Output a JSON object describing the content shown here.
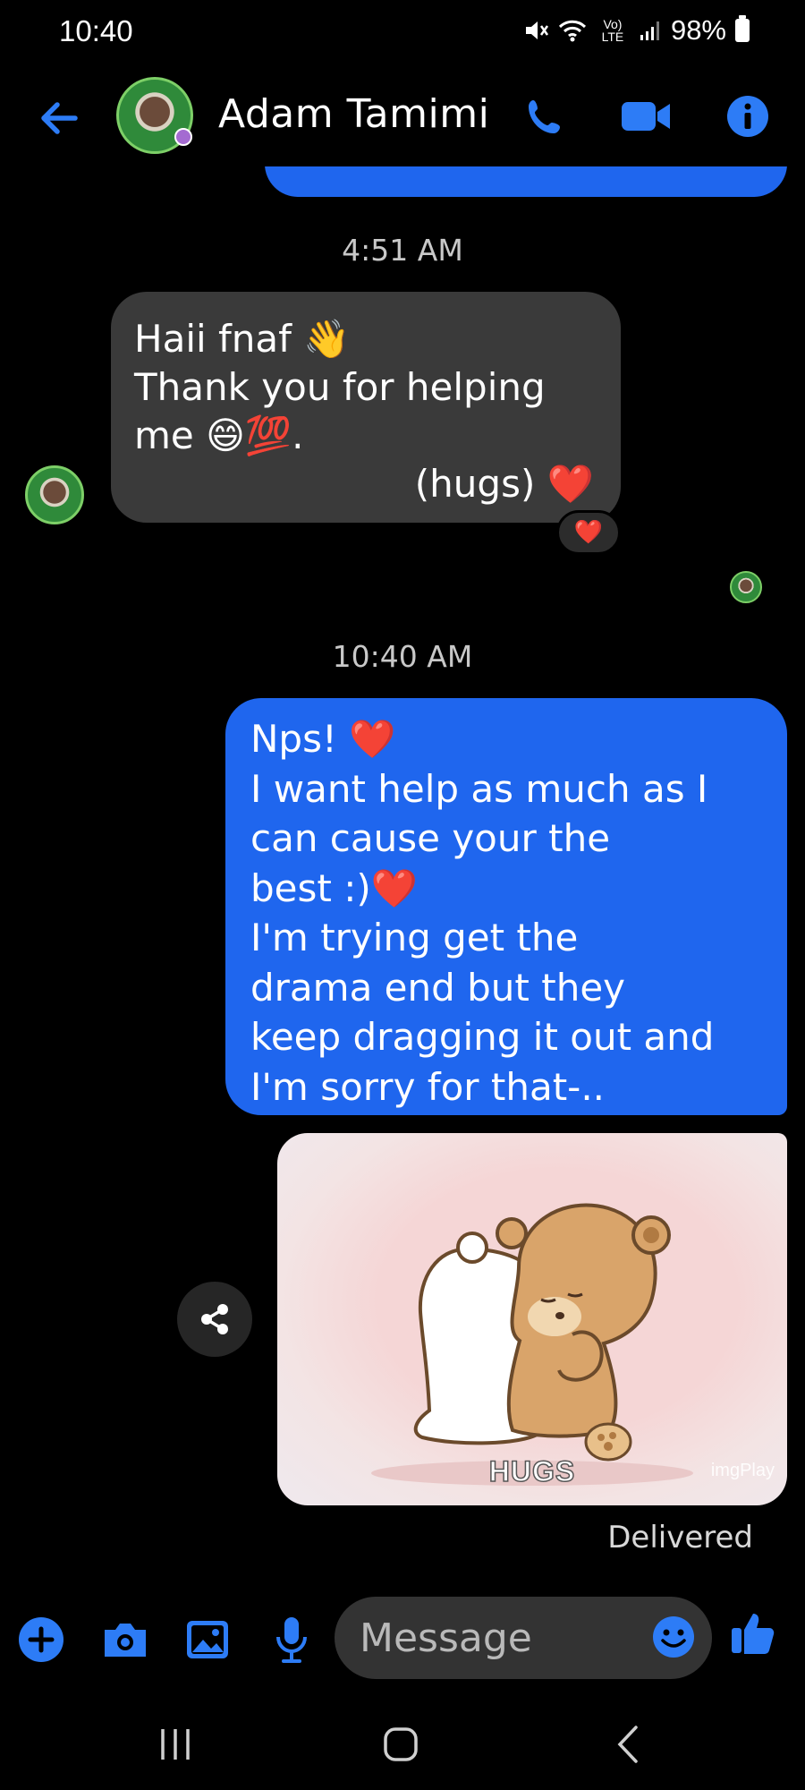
{
  "status_bar": {
    "time": "10:40",
    "network": "Vo) LTE",
    "battery": "98%"
  },
  "header": {
    "contact_name": "Adam Tamimi"
  },
  "messages": {
    "timestamp_1": "4:51 AM",
    "incoming": {
      "lines": [
        "Haii fnaf 👋",
        "Thank you for helping",
        "me 😄💯.",
        "(hugs) ❤️"
      ],
      "reaction": "❤️"
    },
    "timestamp_2": "10:40 AM",
    "outgoing": {
      "lines": [
        "Nps! ❤️",
        "I want help as much as I",
        "can cause your the",
        "best :)❤️",
        "I'm trying get the",
        "drama end but they",
        "keep dragging it out and",
        "I'm sorry for that-.."
      ]
    },
    "gif": {
      "caption": "HUGS",
      "watermark": "imgPlay"
    },
    "delivered": "Delivered"
  },
  "composer": {
    "placeholder": "Message"
  },
  "colors": {
    "accent": "#1f66ee",
    "incoming_bubble": "#3a3a3a",
    "background": "#000000"
  }
}
